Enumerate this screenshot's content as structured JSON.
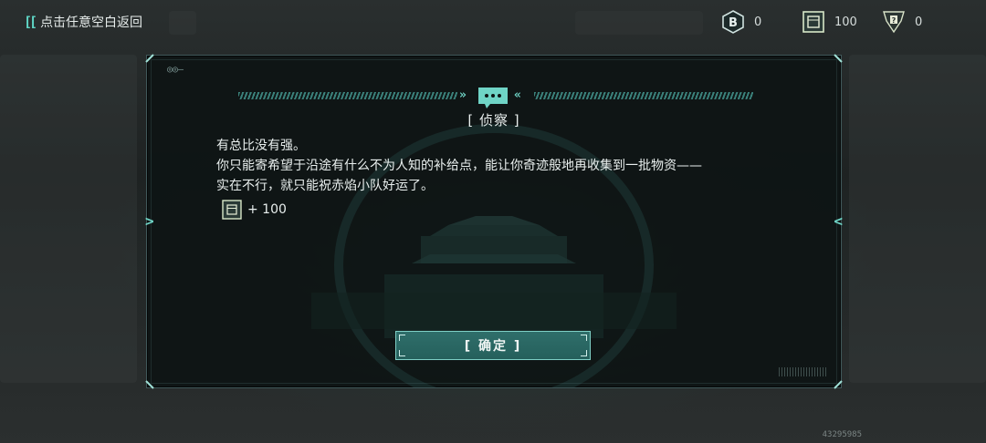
{
  "topbar": {
    "back_label": "点击任意空白返回",
    "resources": [
      {
        "icon": "b-token-icon",
        "value": "0"
      },
      {
        "icon": "supply-crate-icon",
        "value": "100"
      },
      {
        "icon": "pass-card-icon",
        "value": "0"
      }
    ]
  },
  "dialog": {
    "title": "[ 侦察 ]",
    "lines": [
      "有总比没有强。",
      "你只能寄希望于沿途有什么不为人知的补给点，能让你奇迹般地再收集到一批物资——",
      "实在不行，就只能祝赤焰小队好运了。"
    ],
    "reward": {
      "icon": "supply-crate-icon",
      "amount": "+ 100"
    },
    "confirm_label": "[ 确定 ]"
  },
  "footer": {
    "uid": "43295985"
  },
  "colors": {
    "accent": "#5fd6c6",
    "button": "#2f6e6a",
    "panel": "#0e1414"
  }
}
